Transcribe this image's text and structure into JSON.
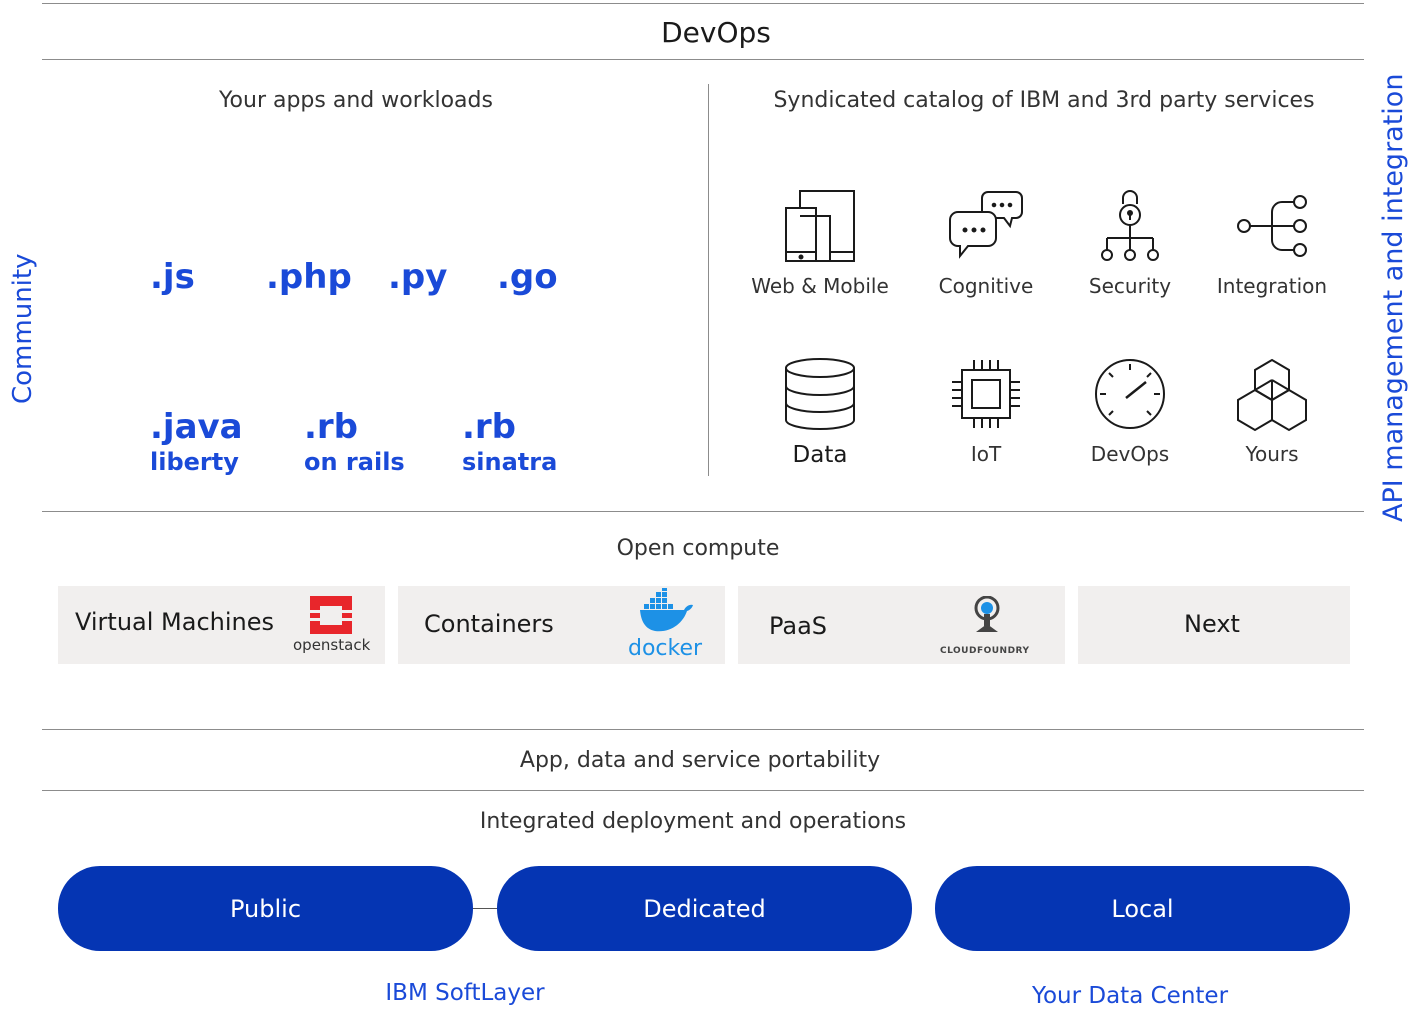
{
  "top": {
    "title": "DevOps"
  },
  "side": {
    "left": "Community",
    "right": "API management and integration"
  },
  "apps": {
    "heading": "Your apps and workloads",
    "languages": [
      {
        "name": ".js",
        "sub": ""
      },
      {
        "name": ".php",
        "sub": ""
      },
      {
        "name": ".py",
        "sub": ""
      },
      {
        "name": ".go",
        "sub": ""
      },
      {
        "name": ".java",
        "sub": "liberty"
      },
      {
        "name": ".rb",
        "sub": "on rails"
      },
      {
        "name": ".rb",
        "sub": "sinatra"
      }
    ]
  },
  "catalog": {
    "heading": "Syndicated catalog of IBM and 3rd party services",
    "services": [
      {
        "label": "Web & Mobile",
        "icon": "web-mobile-icon"
      },
      {
        "label": "Cognitive",
        "icon": "chat-bubbles-icon"
      },
      {
        "label": "Security",
        "icon": "lock-network-icon"
      },
      {
        "label": "Integration",
        "icon": "integration-tree-icon"
      },
      {
        "label": "Data",
        "icon": "database-icon"
      },
      {
        "label": "IoT",
        "icon": "chip-icon"
      },
      {
        "label": "DevOps",
        "icon": "gauge-icon"
      },
      {
        "label": "Yours",
        "icon": "cubes-icon"
      }
    ]
  },
  "compute": {
    "heading": "Open compute",
    "boxes": [
      {
        "label": "Virtual Machines",
        "logo_text": "openstack"
      },
      {
        "label": "Containers",
        "logo_text": "docker"
      },
      {
        "label": "PaaS",
        "logo_text": "CLOUDFOUNDRY"
      },
      {
        "label": "Next",
        "logo_text": ""
      }
    ]
  },
  "portability": {
    "heading": "App, data and service portability"
  },
  "deployment": {
    "heading": "Integrated deployment and operations",
    "pills": [
      "Public",
      "Dedicated",
      "Local"
    ],
    "captions": [
      "IBM SoftLayer",
      "Your Data Center"
    ]
  },
  "colors": {
    "accent": "#0535b3",
    "link_blue": "#1a4ad8",
    "box_bg": "#f1efee",
    "openstack_red": "#e8262b",
    "docker_blue": "#1d91e6"
  }
}
